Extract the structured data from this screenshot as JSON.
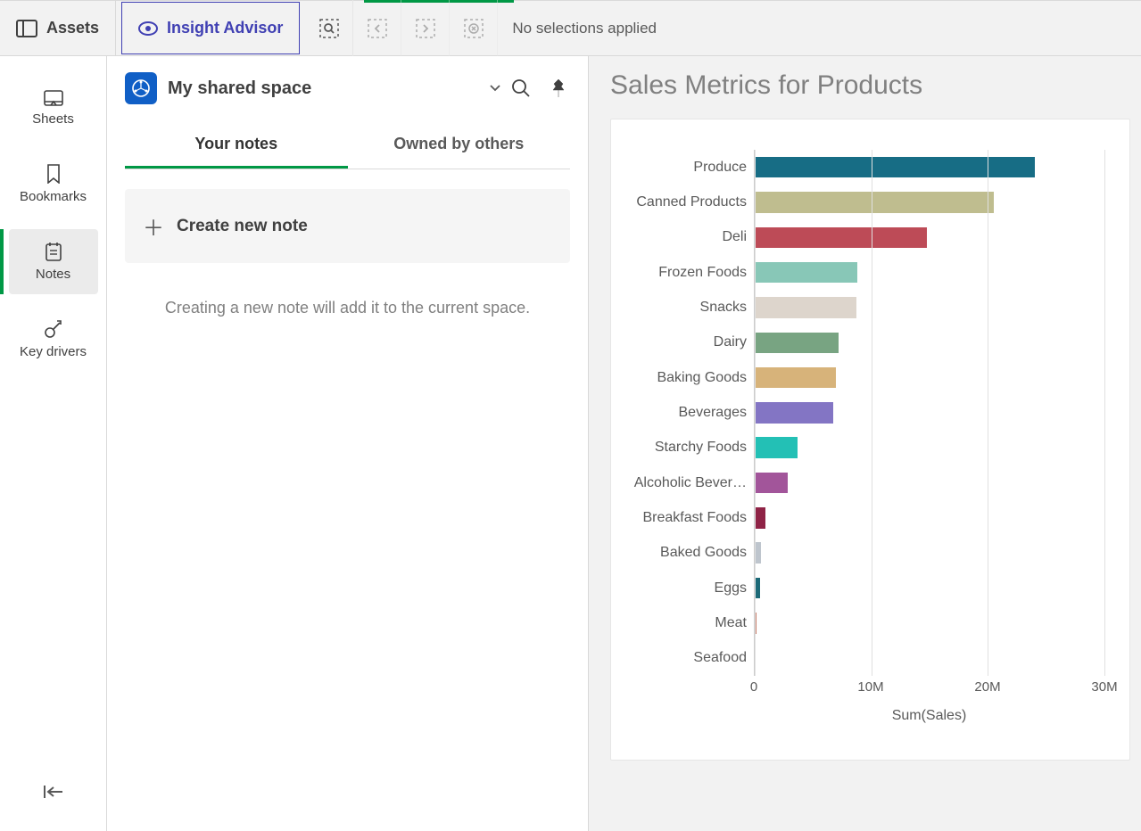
{
  "topbar": {
    "assets": "Assets",
    "insight": "Insight Advisor",
    "no_selections": "No selections applied"
  },
  "sidebar": {
    "items": [
      {
        "label": "Sheets"
      },
      {
        "label": "Bookmarks"
      },
      {
        "label": "Notes"
      },
      {
        "label": "Key drivers"
      }
    ]
  },
  "notes": {
    "space": "My shared space",
    "tabs": [
      {
        "label": "Your notes"
      },
      {
        "label": "Owned by others"
      }
    ],
    "create": "Create new note",
    "hint": "Creating a new note will add it to the current space."
  },
  "chart": {
    "title": "Sales Metrics for Products",
    "xlabel": "Sum(Sales)",
    "x_ticks": [
      "0",
      "10M",
      "20M",
      "30M"
    ]
  },
  "chart_data": {
    "type": "bar",
    "orientation": "horizontal",
    "title": "Sales Metrics for Products",
    "xlabel": "Sum(Sales)",
    "ylabel": "",
    "xlim": [
      0,
      30000000
    ],
    "categories": [
      "Produce",
      "Canned Products",
      "Deli",
      "Frozen Foods",
      "Snacks",
      "Dairy",
      "Baking Goods",
      "Beverages",
      "Starchy Foods",
      "Alcoholic Bever…",
      "Breakfast Foods",
      "Baked Goods",
      "Eggs",
      "Meat",
      "Seafood"
    ],
    "values": [
      24000000,
      20500000,
      14800000,
      8800000,
      8700000,
      7200000,
      7000000,
      6700000,
      3700000,
      2800000,
      900000,
      500000,
      450000,
      150000,
      100000
    ],
    "colors": [
      "#176d85",
      "#bfbd8f",
      "#bd4b57",
      "#88c7b7",
      "#ddd5cc",
      "#78a482",
      "#d7b37a",
      "#8375c4",
      "#23c0b5",
      "#a2559a",
      "#8f2346",
      "#bec5cd",
      "#1c6977",
      "#c77e6a",
      "#e0d2bf"
    ]
  }
}
